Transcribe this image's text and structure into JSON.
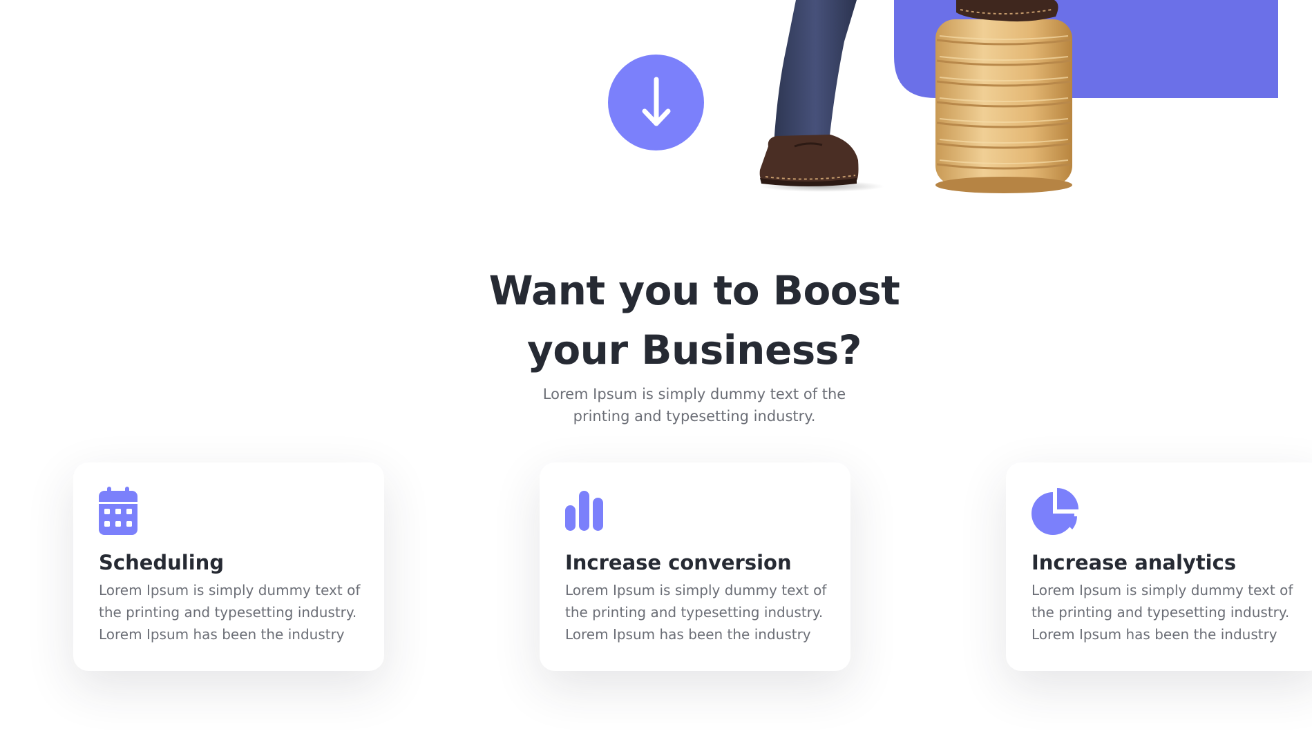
{
  "colors": {
    "accent": "#7b80fb",
    "accent_dark": "#6b70e8",
    "heading": "#262a33",
    "body_text": "#6b6e76",
    "coin_gold": "#e2b978",
    "trousers": "#3b4564",
    "shoe": "#4a2e24"
  },
  "hero": {
    "scroll_icon": "arrow-down-icon",
    "illustration": "businessman-standing-on-coin-stack"
  },
  "section": {
    "title_line1": "Want you to Boost",
    "title_line2": "your Business?",
    "subtitle": "Lorem Ipsum is simply dummy text of the printing and typesetting industry."
  },
  "features": [
    {
      "icon": "calendar-icon",
      "title": "Scheduling",
      "text": "Lorem Ipsum is simply dummy text of the printing and typesetting industry. Lorem Ipsum has been the industry"
    },
    {
      "icon": "bar-chart-icon",
      "title": "Increase conversion",
      "text": "Lorem Ipsum is simply dummy text of the printing and typesetting industry. Lorem Ipsum has been the industry"
    },
    {
      "icon": "pie-chart-icon",
      "title": "Increase analytics",
      "text": "Lorem Ipsum is simply dummy text of the printing and typesetting industry. Lorem Ipsum has been the industry"
    }
  ]
}
